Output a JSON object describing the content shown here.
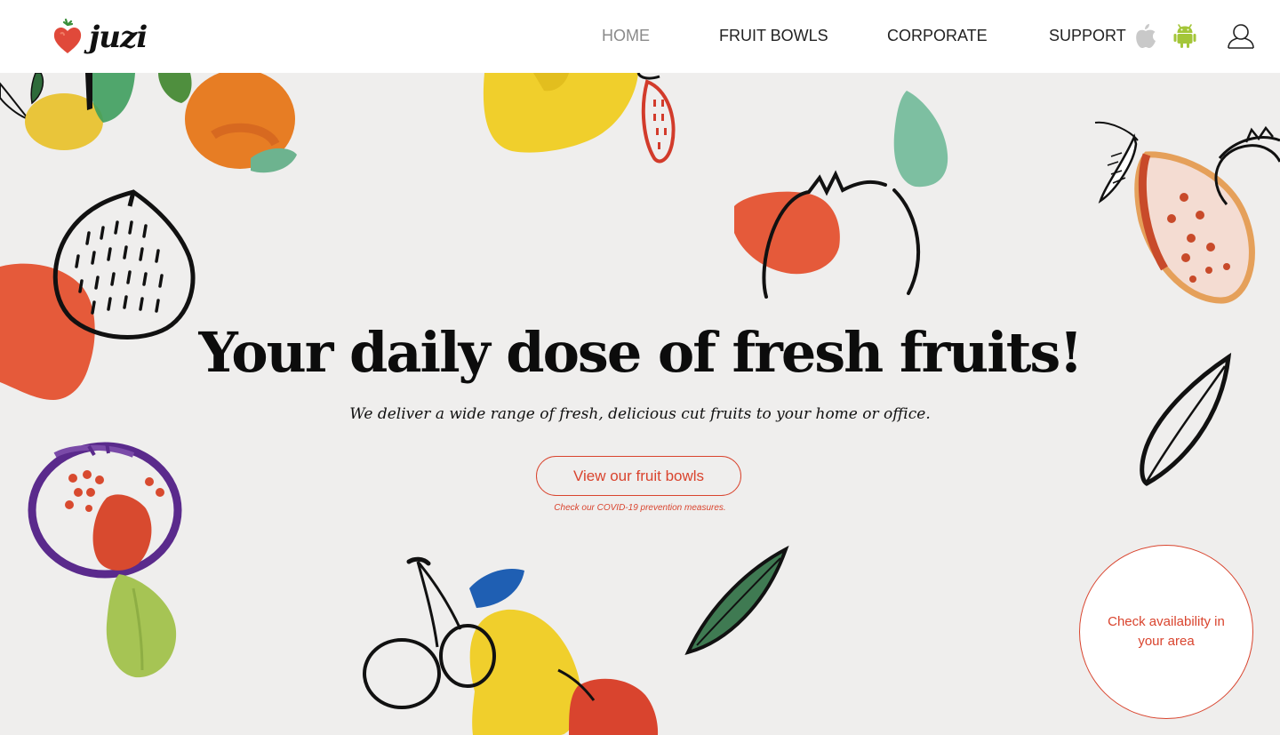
{
  "brand": {
    "name": "juzi"
  },
  "nav": {
    "items": [
      {
        "label": "HOME",
        "active": true
      },
      {
        "label": "FRUIT BOWLS",
        "active": false
      },
      {
        "label": "CORPORATE",
        "active": false
      },
      {
        "label": "SUPPORT",
        "active": false
      }
    ],
    "icons": [
      "apple-icon",
      "android-icon",
      "user-icon"
    ]
  },
  "hero": {
    "title": "Your daily dose of fresh fruits!",
    "subtitle": "We deliver a wide range of fresh, delicious cut fruits to your home or office.",
    "cta_label": "View our fruit bowls",
    "covid_note": "Check our COVID-19 prevention measures.",
    "availability_label": "Check availability in your area"
  },
  "colors": {
    "accent": "#d9442e",
    "hero_background": "#efeeed",
    "nav_active": "#8a8a8a",
    "android_green": "#a4c639"
  }
}
